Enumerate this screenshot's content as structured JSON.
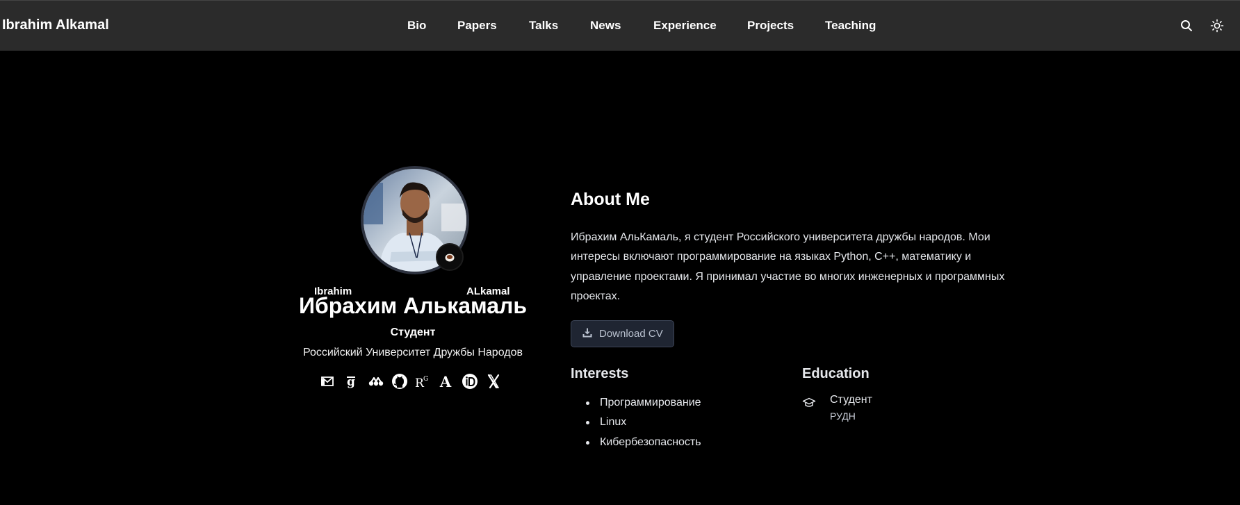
{
  "header": {
    "brand": "Ibrahim Alkamal",
    "nav": [
      "Bio",
      "Papers",
      "Talks",
      "News",
      "Experience",
      "Projects",
      "Teaching"
    ],
    "icons": {
      "search": "search-icon",
      "theme": "sun-icon"
    }
  },
  "profile": {
    "first_name_latin": "Ibrahim",
    "last_name_latin": "ALkamal",
    "display_name": "Ибрахим Алькамаль",
    "role": "Студент",
    "organization": "Российский Университет Дружбы Народов",
    "status_emoji_icon": "coffee-icon",
    "socials": [
      "envelope-icon",
      "google-scholar-icon",
      "mendeley-icon",
      "github-icon",
      "researchgate-icon",
      "academia-icon",
      "orcid-icon",
      "x-twitter-icon"
    ]
  },
  "about": {
    "title": "About Me",
    "bio": "Ибрахим АльКамаль, я студент Российского университета дружбы народов. Мои интересы включают программирование на языках Python, C++, математику и управление проектами. Я принимал участие во многих инженерных и программных проектах.",
    "cv_button": "Download CV"
  },
  "interests": {
    "title": "Interests",
    "items": [
      "Программирование",
      "Linux",
      "Кибербезопасность"
    ]
  },
  "education": {
    "title": "Education",
    "degree": "Студент",
    "institution": "РУДН"
  },
  "colors": {
    "nav_bg": "#2b2b2b",
    "page_bg": "#000000",
    "button_bg": "#1f2532",
    "text": "#ffffff"
  }
}
